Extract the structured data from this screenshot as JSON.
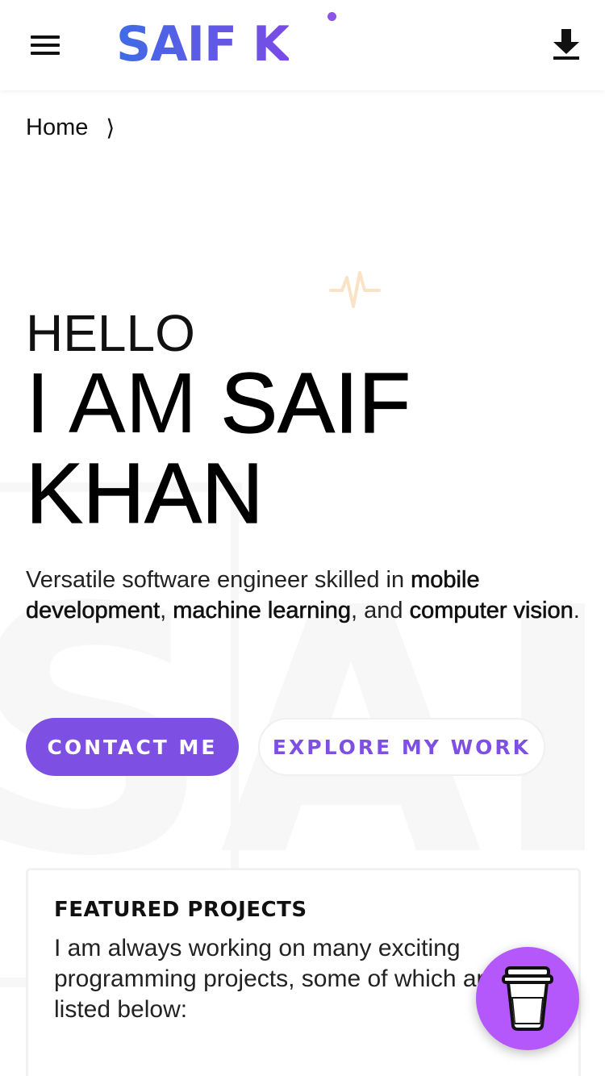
{
  "header": {
    "logo_text": "SAIF K",
    "menu_icon": "hamburger-menu-icon",
    "download_icon": "download-icon"
  },
  "breadcrumb": {
    "home": "Home",
    "separator": "⟩"
  },
  "hero": {
    "greeting": "HELLO",
    "name_prefix": "I AM ",
    "name_first": "SAIF",
    "name_last": "KHAN",
    "tagline": {
      "intro": "Versatile software engineer skilled in ",
      "skill1": "mobile development",
      "sep1": ", ",
      "skill2": "machine learning",
      "sep2": ", and ",
      "skill3": "computer vision",
      "end": "."
    }
  },
  "buttons": {
    "contact": "CONTACT ME",
    "explore": "EXPLORE MY WORK"
  },
  "featured": {
    "title": "FEATURED PROJECTS",
    "description": "I am always working on many exciting programming projects, some of which are listed below:"
  },
  "background": {
    "watermark": "SAIF"
  },
  "colors": {
    "accent": "#7e4fe3",
    "fab": "#b458fb",
    "logo_start": "#3f6be6",
    "logo_end": "#7a4be6",
    "pulse": "#f5a623"
  },
  "fab": {
    "icon": "coffee-cup-icon"
  }
}
